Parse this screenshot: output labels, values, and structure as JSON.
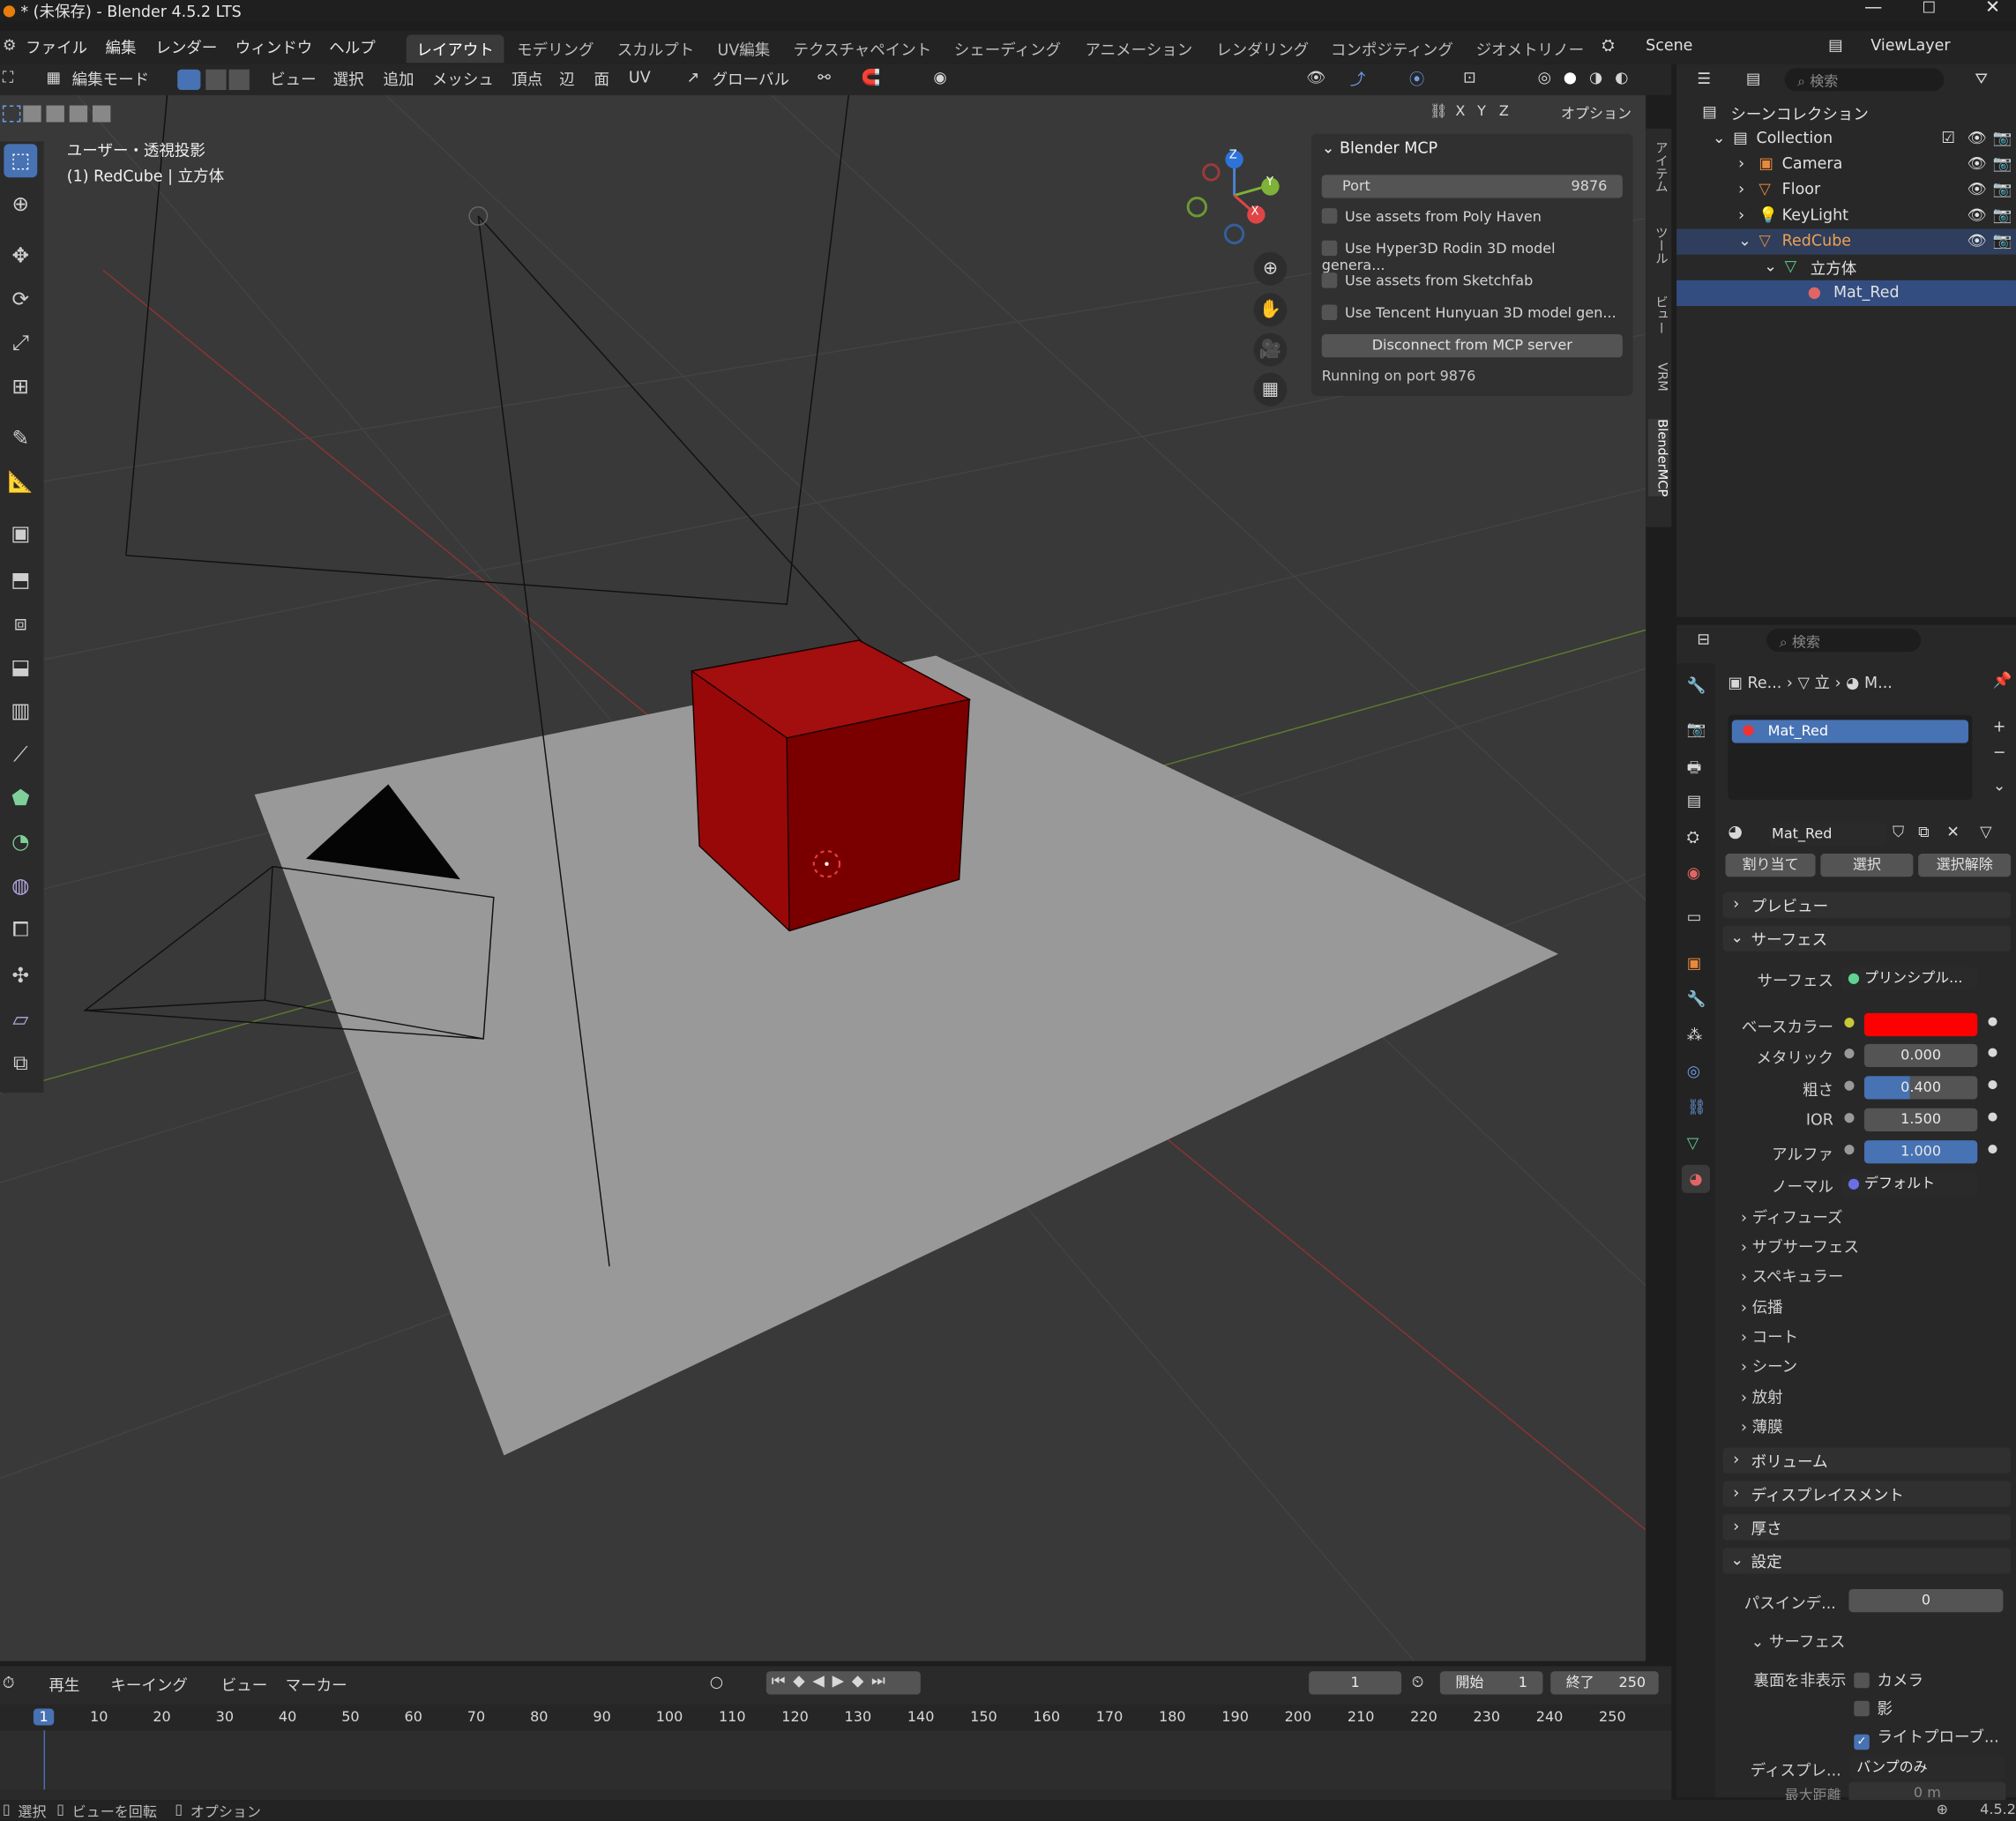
{
  "title": "* (未保存) - Blender 4.5.2 LTS",
  "menu": [
    "ファイル",
    "編集",
    "レンダー",
    "ウィンドウ",
    "ヘルプ"
  ],
  "workspaces": [
    "レイアウト",
    "モデリング",
    "スカルプト",
    "UV編集",
    "テクスチャペイント",
    "シェーディング",
    "アニメーション",
    "レンダリング",
    "コンポジティング",
    "ジオメトリノー"
  ],
  "scene": "Scene",
  "view_layer": "ViewLayer",
  "header": {
    "mode": "編集モード",
    "view": "ビュー",
    "select": "選択",
    "add": "追加",
    "mesh": "メッシュ",
    "vertex": "頂点",
    "edge": "辺",
    "face": "面",
    "uv": "UV",
    "orientation": "グローバル",
    "options": "オプション",
    "axes": [
      "X",
      "Y",
      "Z"
    ]
  },
  "viewport": {
    "view_name": "ユーザー・透視投影",
    "object_info": "(1) RedCube | 立方体",
    "gizmo": {
      "z": "Z",
      "y": "Y",
      "x": "X"
    }
  },
  "mcp": {
    "title": "Blender MCP",
    "port_label": "Port",
    "port_value": "9876",
    "options": [
      "Use assets from Poly Haven",
      "Use Hyper3D Rodin 3D model genera...",
      "Use assets from Sketchfab",
      "Use Tencent Hunyuan 3D model gen..."
    ],
    "disconnect": "Disconnect from MCP server",
    "status": "Running on port 9876"
  },
  "sidetabs": [
    "アイテム",
    "ツール",
    "ビュー",
    "VRM",
    "BlenderMCP"
  ],
  "outliner": {
    "search": "検索",
    "root": "シーンコレクション",
    "items": [
      {
        "label": "Collection"
      },
      {
        "label": "Camera"
      },
      {
        "label": "Floor"
      },
      {
        "label": "KeyLight"
      },
      {
        "label": "RedCube"
      },
      {
        "label": "立方体"
      },
      {
        "label": "Mat_Red"
      }
    ]
  },
  "properties": {
    "search": "検索",
    "breadcrumb": [
      "Re...",
      "立",
      "M..."
    ],
    "slot": "Mat_Red",
    "material": "Mat_Red",
    "assign": "割り当て",
    "select": "選択",
    "deselect": "選択解除",
    "sections": {
      "preview": "プレビュー",
      "surface": "サーフェス",
      "volume": "ボリューム",
      "displacement": "ディスプレイスメント",
      "thickness": "厚さ",
      "settings": "設定"
    },
    "surface_label": "サーフェス",
    "surface_value": "プリンシプル...",
    "fields": [
      {
        "label": "ベースカラー",
        "value": ""
      },
      {
        "label": "メタリック",
        "value": "0.000"
      },
      {
        "label": "粗さ",
        "value": "0.400"
      },
      {
        "label": "IOR",
        "value": "1.500"
      },
      {
        "label": "アルファ",
        "value": "1.000"
      },
      {
        "label": "ノーマル",
        "value": "デフォルト"
      }
    ],
    "subsections": [
      "ディフューズ",
      "サブサーフェス",
      "スペキュラー",
      "伝播",
      "コート",
      "シーン",
      "放射",
      "薄膜"
    ],
    "pass_index_label": "パスインデ...",
    "pass_index": "0",
    "settings_surface": "サーフェス",
    "backface_label": "裏面を非表示",
    "camera": "カメラ",
    "shadow": "影",
    "lightprobe": "ライトプローブ...",
    "displacement_label": "ディスプレ...",
    "displacement_value": "バンプのみ",
    "max_distance_label": "最大距離",
    "max_distance": "0 m",
    "base_color": "#ff0000"
  },
  "timeline": {
    "playback": "再生",
    "keying": "キーイング",
    "view": "ビュー",
    "marker": "マーカー",
    "current": "1",
    "start_label": "開始",
    "start": "1",
    "end_label": "終了",
    "end": "250",
    "ticks": [
      "1",
      "10",
      "20",
      "30",
      "40",
      "50",
      "60",
      "70",
      "80",
      "90",
      "100",
      "110",
      "120",
      "130",
      "140",
      "150",
      "160",
      "170",
      "180",
      "190",
      "200",
      "210",
      "220",
      "230",
      "240",
      "250"
    ]
  },
  "status": {
    "select": "選択",
    "rotate": "ビューを回転",
    "options": "オプション",
    "version": "4.5.2"
  }
}
